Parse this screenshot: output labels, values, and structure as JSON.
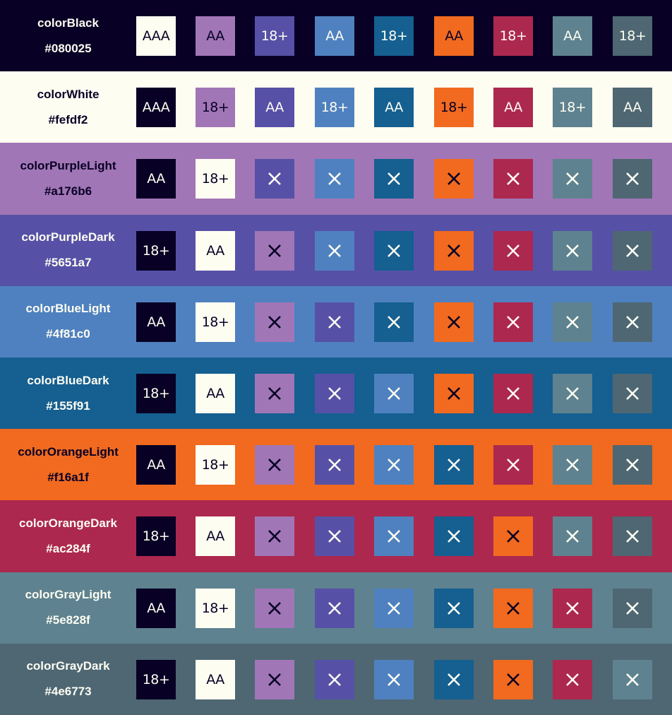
{
  "colors": [
    {
      "name": "colorBlack",
      "hex": "#080025"
    },
    {
      "name": "colorWhite",
      "hex": "#fefdf2"
    },
    {
      "name": "colorPurpleLight",
      "hex": "#a176b6"
    },
    {
      "name": "colorPurpleDark",
      "hex": "#5651a7"
    },
    {
      "name": "colorBlueLight",
      "hex": "#4f81c0"
    },
    {
      "name": "colorBlueDark",
      "hex": "#155f91"
    },
    {
      "name": "colorOrangeLight",
      "hex": "#f16a1f"
    },
    {
      "name": "colorOrangeDark",
      "hex": "#ac284f"
    },
    {
      "name": "colorGrayLight",
      "hex": "#5e828f"
    },
    {
      "name": "colorGrayDark",
      "hex": "#4e6773"
    }
  ],
  "rows": [
    {
      "label_color": "#fefdf2",
      "cells": [
        {
          "bg": "#fefdf2",
          "text": "AAA",
          "fg": "#080025"
        },
        {
          "bg": "#a176b6",
          "text": "AA",
          "fg": "#080025"
        },
        {
          "bg": "#5651a7",
          "text": "18+",
          "fg": "#fefdf2"
        },
        {
          "bg": "#4f81c0",
          "text": "AA",
          "fg": "#fefdf2"
        },
        {
          "bg": "#155f91",
          "text": "18+",
          "fg": "#fefdf2"
        },
        {
          "bg": "#f16a1f",
          "text": "AA",
          "fg": "#080025"
        },
        {
          "bg": "#ac284f",
          "text": "18+",
          "fg": "#fefdf2"
        },
        {
          "bg": "#5e828f",
          "text": "AA",
          "fg": "#fefdf2"
        },
        {
          "bg": "#4e6773",
          "text": "18+",
          "fg": "#fefdf2"
        }
      ]
    },
    {
      "label_color": "#080025",
      "cells": [
        {
          "bg": "#080025",
          "text": "AAA",
          "fg": "#fefdf2"
        },
        {
          "bg": "#a176b6",
          "text": "18+",
          "fg": "#080025"
        },
        {
          "bg": "#5651a7",
          "text": "AA",
          "fg": "#fefdf2"
        },
        {
          "bg": "#4f81c0",
          "text": "18+",
          "fg": "#fefdf2"
        },
        {
          "bg": "#155f91",
          "text": "AA",
          "fg": "#fefdf2"
        },
        {
          "bg": "#f16a1f",
          "text": "18+",
          "fg": "#080025"
        },
        {
          "bg": "#ac284f",
          "text": "AA",
          "fg": "#fefdf2"
        },
        {
          "bg": "#5e828f",
          "text": "18+",
          "fg": "#fefdf2"
        },
        {
          "bg": "#4e6773",
          "text": "AA",
          "fg": "#fefdf2"
        }
      ]
    },
    {
      "label_color": "#080025",
      "cells": [
        {
          "bg": "#080025",
          "text": "AA",
          "fg": "#fefdf2"
        },
        {
          "bg": "#fefdf2",
          "text": "18+",
          "fg": "#080025"
        },
        {
          "bg": "#5651a7",
          "text": "",
          "fg": "#fefdf2"
        },
        {
          "bg": "#4f81c0",
          "text": "",
          "fg": "#fefdf2"
        },
        {
          "bg": "#155f91",
          "text": "",
          "fg": "#fefdf2"
        },
        {
          "bg": "#f16a1f",
          "text": "",
          "fg": "#080025"
        },
        {
          "bg": "#ac284f",
          "text": "",
          "fg": "#fefdf2"
        },
        {
          "bg": "#5e828f",
          "text": "",
          "fg": "#fefdf2"
        },
        {
          "bg": "#4e6773",
          "text": "",
          "fg": "#fefdf2"
        }
      ]
    },
    {
      "label_color": "#fefdf2",
      "cells": [
        {
          "bg": "#080025",
          "text": "18+",
          "fg": "#fefdf2"
        },
        {
          "bg": "#fefdf2",
          "text": "AA",
          "fg": "#080025"
        },
        {
          "bg": "#a176b6",
          "text": "",
          "fg": "#080025"
        },
        {
          "bg": "#4f81c0",
          "text": "",
          "fg": "#fefdf2"
        },
        {
          "bg": "#155f91",
          "text": "",
          "fg": "#fefdf2"
        },
        {
          "bg": "#f16a1f",
          "text": "",
          "fg": "#080025"
        },
        {
          "bg": "#ac284f",
          "text": "",
          "fg": "#fefdf2"
        },
        {
          "bg": "#5e828f",
          "text": "",
          "fg": "#fefdf2"
        },
        {
          "bg": "#4e6773",
          "text": "",
          "fg": "#fefdf2"
        }
      ]
    },
    {
      "label_color": "#fefdf2",
      "cells": [
        {
          "bg": "#080025",
          "text": "AA",
          "fg": "#fefdf2"
        },
        {
          "bg": "#fefdf2",
          "text": "18+",
          "fg": "#080025"
        },
        {
          "bg": "#a176b6",
          "text": "",
          "fg": "#080025"
        },
        {
          "bg": "#5651a7",
          "text": "",
          "fg": "#fefdf2"
        },
        {
          "bg": "#155f91",
          "text": "",
          "fg": "#fefdf2"
        },
        {
          "bg": "#f16a1f",
          "text": "",
          "fg": "#080025"
        },
        {
          "bg": "#ac284f",
          "text": "",
          "fg": "#fefdf2"
        },
        {
          "bg": "#5e828f",
          "text": "",
          "fg": "#fefdf2"
        },
        {
          "bg": "#4e6773",
          "text": "",
          "fg": "#fefdf2"
        }
      ]
    },
    {
      "label_color": "#fefdf2",
      "cells": [
        {
          "bg": "#080025",
          "text": "18+",
          "fg": "#fefdf2"
        },
        {
          "bg": "#fefdf2",
          "text": "AA",
          "fg": "#080025"
        },
        {
          "bg": "#a176b6",
          "text": "",
          "fg": "#080025"
        },
        {
          "bg": "#5651a7",
          "text": "",
          "fg": "#fefdf2"
        },
        {
          "bg": "#4f81c0",
          "text": "",
          "fg": "#fefdf2"
        },
        {
          "bg": "#f16a1f",
          "text": "",
          "fg": "#080025"
        },
        {
          "bg": "#ac284f",
          "text": "",
          "fg": "#fefdf2"
        },
        {
          "bg": "#5e828f",
          "text": "",
          "fg": "#fefdf2"
        },
        {
          "bg": "#4e6773",
          "text": "",
          "fg": "#fefdf2"
        }
      ]
    },
    {
      "label_color": "#080025",
      "cells": [
        {
          "bg": "#080025",
          "text": "AA",
          "fg": "#fefdf2"
        },
        {
          "bg": "#fefdf2",
          "text": "18+",
          "fg": "#080025"
        },
        {
          "bg": "#a176b6",
          "text": "",
          "fg": "#080025"
        },
        {
          "bg": "#5651a7",
          "text": "",
          "fg": "#fefdf2"
        },
        {
          "bg": "#4f81c0",
          "text": "",
          "fg": "#fefdf2"
        },
        {
          "bg": "#155f91",
          "text": "",
          "fg": "#fefdf2"
        },
        {
          "bg": "#ac284f",
          "text": "",
          "fg": "#fefdf2"
        },
        {
          "bg": "#5e828f",
          "text": "",
          "fg": "#fefdf2"
        },
        {
          "bg": "#4e6773",
          "text": "",
          "fg": "#fefdf2"
        }
      ]
    },
    {
      "label_color": "#fefdf2",
      "cells": [
        {
          "bg": "#080025",
          "text": "18+",
          "fg": "#fefdf2"
        },
        {
          "bg": "#fefdf2",
          "text": "AA",
          "fg": "#080025"
        },
        {
          "bg": "#a176b6",
          "text": "",
          "fg": "#080025"
        },
        {
          "bg": "#5651a7",
          "text": "",
          "fg": "#fefdf2"
        },
        {
          "bg": "#4f81c0",
          "text": "",
          "fg": "#fefdf2"
        },
        {
          "bg": "#155f91",
          "text": "",
          "fg": "#fefdf2"
        },
        {
          "bg": "#f16a1f",
          "text": "",
          "fg": "#080025"
        },
        {
          "bg": "#5e828f",
          "text": "",
          "fg": "#fefdf2"
        },
        {
          "bg": "#4e6773",
          "text": "",
          "fg": "#fefdf2"
        }
      ]
    },
    {
      "label_color": "#fefdf2",
      "cells": [
        {
          "bg": "#080025",
          "text": "AA",
          "fg": "#fefdf2"
        },
        {
          "bg": "#fefdf2",
          "text": "18+",
          "fg": "#080025"
        },
        {
          "bg": "#a176b6",
          "text": "",
          "fg": "#080025"
        },
        {
          "bg": "#5651a7",
          "text": "",
          "fg": "#fefdf2"
        },
        {
          "bg": "#4f81c0",
          "text": "",
          "fg": "#fefdf2"
        },
        {
          "bg": "#155f91",
          "text": "",
          "fg": "#fefdf2"
        },
        {
          "bg": "#f16a1f",
          "text": "",
          "fg": "#080025"
        },
        {
          "bg": "#ac284f",
          "text": "",
          "fg": "#fefdf2"
        },
        {
          "bg": "#4e6773",
          "text": "",
          "fg": "#fefdf2"
        }
      ]
    },
    {
      "label_color": "#fefdf2",
      "cells": [
        {
          "bg": "#080025",
          "text": "18+",
          "fg": "#fefdf2"
        },
        {
          "bg": "#fefdf2",
          "text": "AA",
          "fg": "#080025"
        },
        {
          "bg": "#a176b6",
          "text": "",
          "fg": "#080025"
        },
        {
          "bg": "#5651a7",
          "text": "",
          "fg": "#fefdf2"
        },
        {
          "bg": "#4f81c0",
          "text": "",
          "fg": "#fefdf2"
        },
        {
          "bg": "#155f91",
          "text": "",
          "fg": "#fefdf2"
        },
        {
          "bg": "#f16a1f",
          "text": "",
          "fg": "#080025"
        },
        {
          "bg": "#ac284f",
          "text": "",
          "fg": "#fefdf2"
        },
        {
          "bg": "#5e828f",
          "text": "",
          "fg": "#fefdf2"
        }
      ]
    }
  ]
}
